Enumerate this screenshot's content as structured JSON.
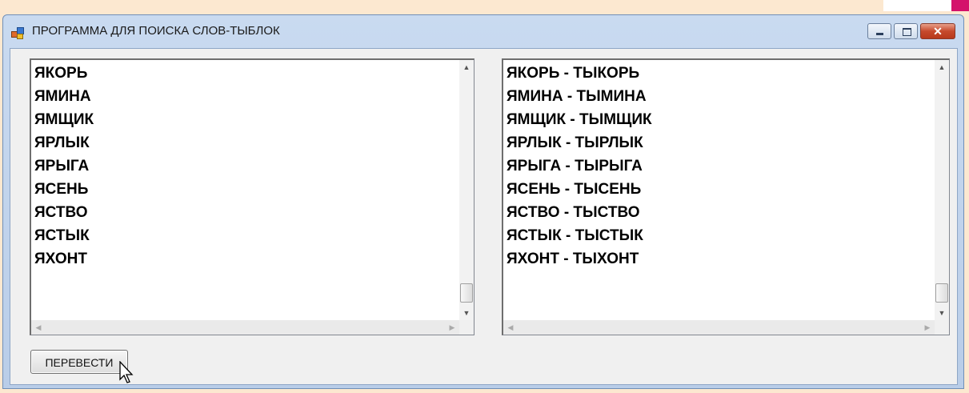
{
  "window": {
    "title": "ПРОГРАММА ДЛЯ ПОИСКА СЛОВ-ТЫБЛОК",
    "controls": {
      "minimize": "–",
      "maximize": "□",
      "close": "✕"
    }
  },
  "left_list": {
    "items": [
      "ЯКОРЬ",
      "ЯМИНА",
      "ЯМЩИК",
      "ЯРЛЫК",
      "ЯРЫГА",
      "ЯСЕНЬ",
      "ЯСТВО",
      "ЯСТЫК",
      "ЯХОНТ"
    ]
  },
  "right_list": {
    "items": [
      "ЯКОРЬ - ТЫКОРЬ",
      "ЯМИНА - ТЫМИНА",
      "ЯМЩИК - ТЫМЩИК",
      "ЯРЛЫК - ТЫРЛЫК",
      "ЯРЫГА - ТЫРЫГА",
      "ЯСЕНЬ - ТЫСЕНЬ",
      "ЯСТВО - ТЫСТВО",
      "ЯСТЫК - ТЫСТЫК",
      "ЯХОНТ - ТЫХОНТ"
    ]
  },
  "scroll": {
    "up_arrow": "▲",
    "down_arrow": "▼",
    "left_arrow": "◀",
    "right_arrow": "▶"
  },
  "buttons": {
    "translate": "ПЕРЕВЕСТИ"
  },
  "colors": {
    "background": "#fce8d0",
    "accent": "#d4126b",
    "titlebar": "#c9daf0"
  },
  "icons": {
    "app": "app-icon",
    "cursor": "mouse-pointer-icon"
  }
}
